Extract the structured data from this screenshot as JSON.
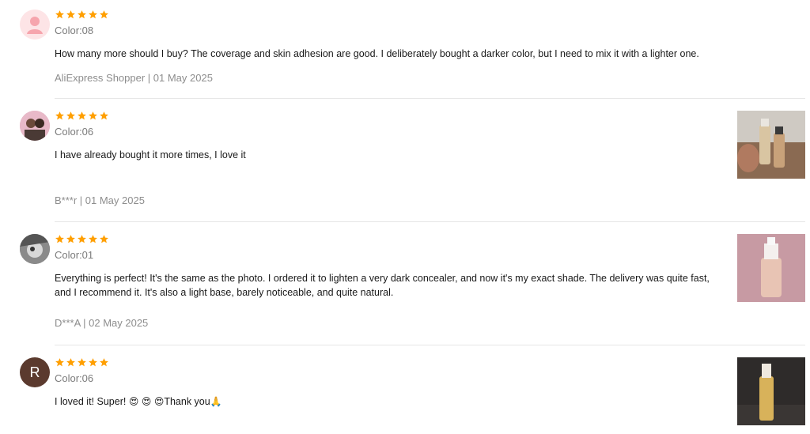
{
  "accent": {
    "star": "#FF9F00",
    "divider": "#E6E6E6"
  },
  "reviews": [
    {
      "rating": 5,
      "color_label": "Color:08",
      "text": "How many more should I buy? The coverage and skin adhesion are good. I deliberately bought a darker color, but I need to mix it with a lighter one.",
      "meta": "AliExpress Shopper | 01 May 2025",
      "avatar": "default-user-icon",
      "has_photo": false
    },
    {
      "rating": 5,
      "color_label": "Color:06",
      "text": "I have already bought it more times, I love it",
      "meta": "B***r | 01 May 2025",
      "avatar": "user-photo",
      "has_photo": true
    },
    {
      "rating": 5,
      "color_label": "Color:01",
      "text": "Everything is perfect! It's the same as the photo. I ordered it to lighten a very dark concealer, and now it's my exact shade. The delivery was quite fast, and I recommend it. It's also a light base, barely noticeable, and quite natural.",
      "meta": "D***A | 02 May 2025",
      "avatar": "user-photo",
      "has_photo": true
    },
    {
      "rating": 5,
      "color_label": "Color:06",
      "text_prefix": "I loved it! Super!",
      "text_suffix": "Thank you",
      "avatar_letter": "R",
      "avatar": "letter-avatar",
      "has_photo": true
    }
  ]
}
